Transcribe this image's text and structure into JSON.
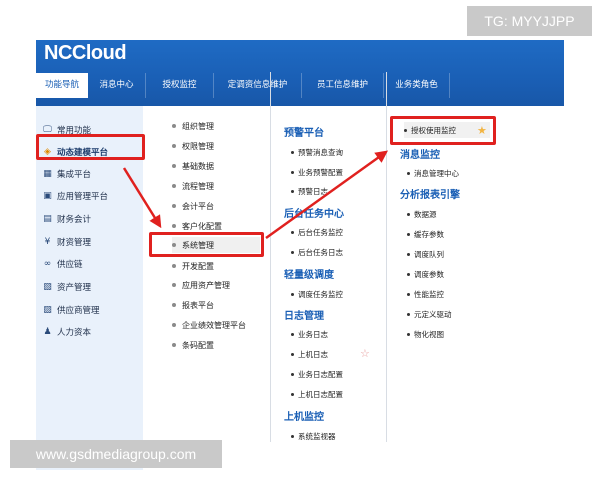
{
  "brand": {
    "logo_text": "NCCloud"
  },
  "nav": {
    "tabs": [
      "功能导航",
      "消息中心",
      "授权监控",
      "定调资信息维护",
      "员工信息维护",
      "业务类角色"
    ],
    "active_index": 0
  },
  "left_menu": {
    "items": [
      {
        "label": "常用功能",
        "icon": "monitor-icon",
        "glyph": "🖵"
      },
      {
        "label": "动态建模平台",
        "icon": "cube-icon",
        "glyph": "◈"
      },
      {
        "label": "集成平台",
        "icon": "integration-icon",
        "glyph": "▦"
      },
      {
        "label": "应用管理平台",
        "icon": "app-grid-icon",
        "glyph": "▣"
      },
      {
        "label": "财务会计",
        "icon": "ledger-icon",
        "glyph": "▤"
      },
      {
        "label": "财资管理",
        "icon": "yen-icon",
        "glyph": "¥"
      },
      {
        "label": "供应链",
        "icon": "link-icon",
        "glyph": "∞"
      },
      {
        "label": "资产管理",
        "icon": "asset-icon",
        "glyph": "▧"
      },
      {
        "label": "供应商管理",
        "icon": "supplier-icon",
        "glyph": "▨"
      },
      {
        "label": "人力资本",
        "icon": "people-icon",
        "glyph": "♟"
      }
    ],
    "active_index": 1
  },
  "middle_menu": {
    "items": [
      "组织管理",
      "权限管理",
      "基础数据",
      "流程管理",
      "会计平台",
      "客户化配置",
      "系统管理",
      "开发配置",
      "应用资产管理",
      "报表平台",
      "企业绩效管理平台",
      "条码配置"
    ],
    "active_index": 6
  },
  "col3": {
    "sections": [
      {
        "title": "预警平台",
        "items": [
          "预警消息查询",
          "业务预警配置",
          "预警日志"
        ]
      },
      {
        "title": "后台任务中心",
        "items": [
          "后台任务监控",
          "后台任务日志"
        ]
      },
      {
        "title": "轻量级调度",
        "items": [
          "调度任务监控"
        ]
      },
      {
        "title": "日志管理",
        "items": [
          "业务日志",
          "上机日志",
          "业务日志配置",
          "上机日志配置"
        ]
      },
      {
        "title": "上机监控",
        "items": [
          "系统监视器"
        ]
      }
    ]
  },
  "col4": {
    "highlight_item": "授权使用监控",
    "sections": [
      {
        "title": "消息监控",
        "items": [
          "消息管理中心"
        ]
      },
      {
        "title": "分析报表引擎",
        "items": [
          "数据源",
          "缓存参数",
          "调度队列",
          "调度参数",
          "性能监控",
          "元定义驱动",
          "物化视图"
        ]
      }
    ]
  },
  "watermarks": {
    "top_right": "TG: MYYJJPP",
    "bottom_left": "www.gsdmediagroup.com"
  },
  "colors": {
    "header_blue": "#1a5fb5",
    "highlight_red": "#e0211f",
    "left_bg": "#e9f1fb",
    "star_gold": "#f2b441"
  }
}
